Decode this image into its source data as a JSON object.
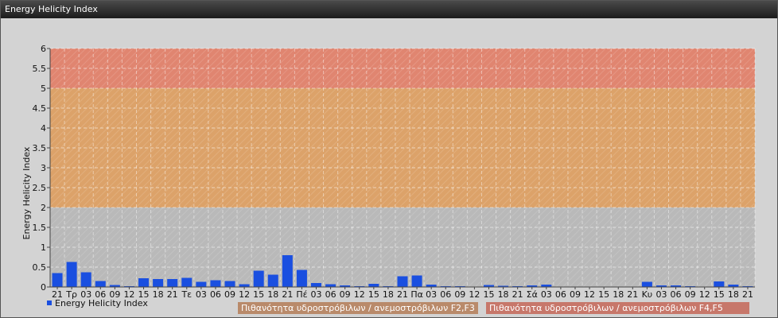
{
  "window": {
    "title": "Energy Helicity Index"
  },
  "chart_data": {
    "type": "bar",
    "ylabel": "Energy Helicity Index",
    "ylim": [
      0,
      6
    ],
    "yticks": [
      "0",
      "0.5",
      "1",
      "1.5",
      "2",
      "2.5",
      "3",
      "3.5",
      "4",
      "4.5",
      "5",
      "5.5",
      "6"
    ],
    "categories": [
      "21",
      "Τρ",
      "03",
      "06",
      "09",
      "12",
      "15",
      "18",
      "21",
      "Τε",
      "03",
      "06",
      "09",
      "12",
      "15",
      "18",
      "21",
      "Πέ",
      "03",
      "06",
      "09",
      "12",
      "15",
      "18",
      "21",
      "Πα",
      "03",
      "06",
      "09",
      "12",
      "15",
      "18",
      "21",
      "Σά",
      "03",
      "06",
      "09",
      "12",
      "15",
      "18",
      "21",
      "Κυ",
      "03",
      "06",
      "09",
      "12",
      "15",
      "18",
      "21"
    ],
    "values": [
      0.35,
      0.63,
      0.37,
      0.15,
      0.05,
      0.02,
      0.22,
      0.2,
      0.2,
      0.23,
      0.13,
      0.17,
      0.15,
      0.07,
      0.41,
      0.31,
      0.8,
      0.43,
      0.1,
      0.07,
      0.04,
      0.02,
      0.08,
      0.02,
      0.27,
      0.29,
      0.06,
      0.02,
      0.02,
      0.01,
      0.05,
      0.03,
      0.02,
      0.04,
      0.06,
      0.01,
      0.01,
      0.01,
      0.01,
      0.01,
      0.01,
      0.13,
      0.04,
      0.04,
      0.02,
      0.01,
      0.14,
      0.06,
      0.02
    ],
    "grid": true,
    "bands": [
      {
        "from": 2,
        "to": 5,
        "color": "#e0a060"
      },
      {
        "from": 5,
        "to": 6,
        "color": "#e48068"
      }
    ],
    "bar_color": "#1a4fe0",
    "legend": [
      {
        "name": "Energy Helicity Index",
        "color": "#1a4fe0"
      },
      {
        "name": "Πιθανότητα υδροστρόβιλων / ανεμοστρόβιλων F2,F3",
        "color": "#b98a6a"
      },
      {
        "name": "Πιθανότητα υδροστρόβιλων / ανεμοστρόβιλων F4,F5",
        "color": "#c7776a"
      }
    ],
    "legend_position": "bottom"
  }
}
